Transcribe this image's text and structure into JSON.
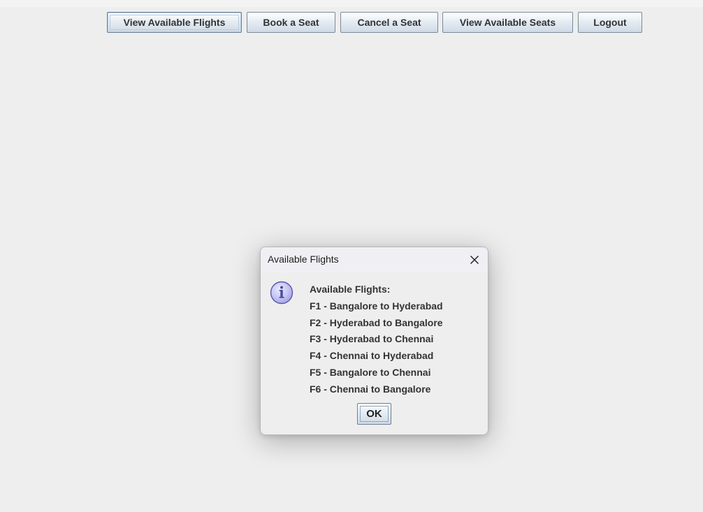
{
  "toolbar": {
    "buttons": [
      {
        "label": "View Available Flights",
        "focused": true
      },
      {
        "label": "Book a Seat",
        "focused": false
      },
      {
        "label": "Cancel a Seat",
        "focused": false
      },
      {
        "label": "View Available Seats",
        "focused": false
      },
      {
        "label": "Logout",
        "focused": false
      }
    ]
  },
  "dialog": {
    "title": "Available Flights",
    "icon": "info-icon",
    "message_lines": [
      "Available Flights:",
      "F1 - Bangalore to Hyderabad",
      "F2 - Hyderabad to Bangalore",
      "F3 - Hyderabad to Chennai",
      "F4 - Chennai to Hyderabad",
      "F5 - Bangalore to Chennai",
      "F6 - Chennai to Bangalore"
    ],
    "ok_label": "OK"
  },
  "colors": {
    "background": "#eeeeee",
    "button_border": "#7a8a99",
    "button_text": "#333333",
    "info_icon_fill": "#c7c6f5",
    "info_icon_stroke": "#5a59a8"
  }
}
